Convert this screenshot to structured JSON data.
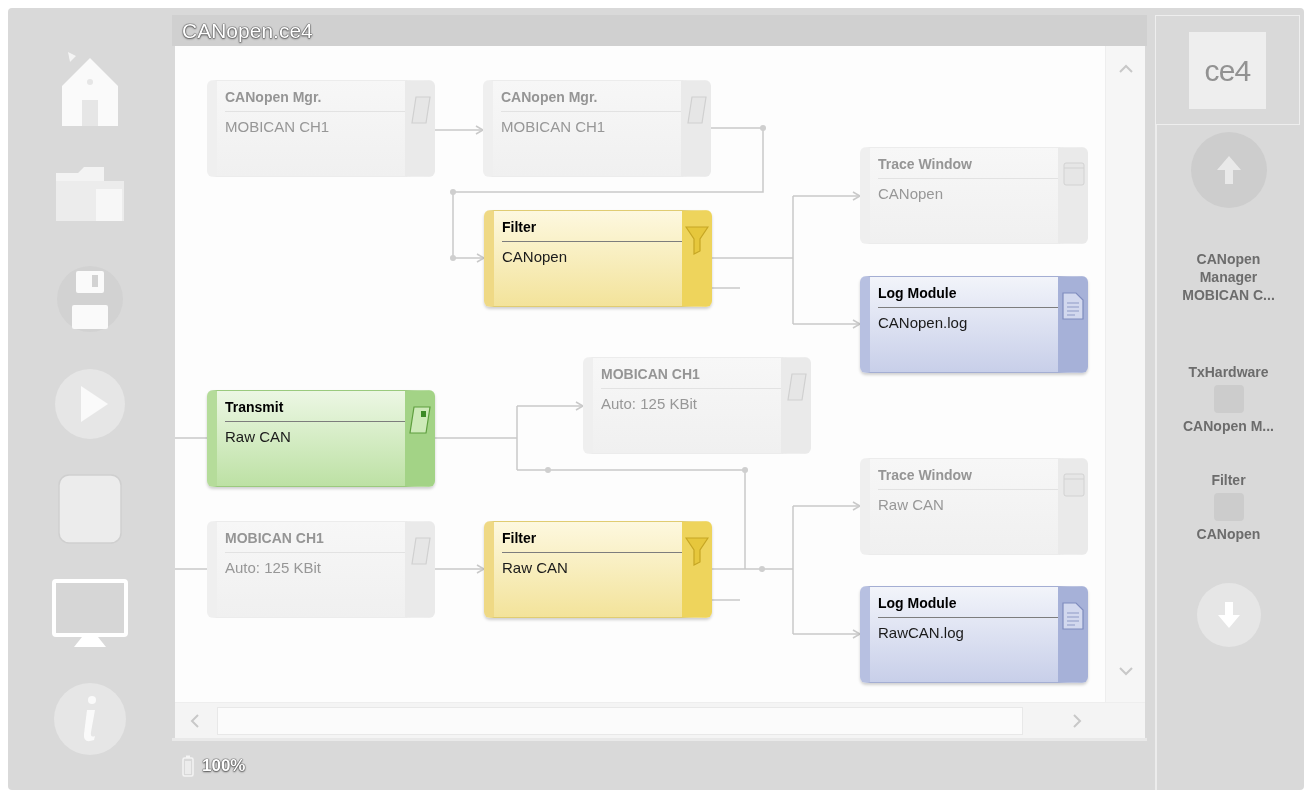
{
  "window": {
    "title": "CANopen.ce4"
  },
  "diagram": {
    "nodes": [
      {
        "kind": "manager",
        "title": "CANopen Mgr.",
        "subtitle": "MOBICAN CH1",
        "disabled": true
      },
      {
        "kind": "manager",
        "title": "CANopen Mgr.",
        "subtitle": "MOBICAN CH1",
        "disabled": true
      },
      {
        "kind": "trace",
        "title": "Trace Window",
        "subtitle": "CANopen",
        "disabled": true
      },
      {
        "kind": "filter",
        "title": "Filter",
        "subtitle": "CANopen",
        "disabled": false
      },
      {
        "kind": "log",
        "title": "Log Module",
        "subtitle": "CANopen.log",
        "disabled": false
      },
      {
        "kind": "hardware",
        "title": "MOBICAN CH1",
        "subtitle": "Auto: 125 KBit",
        "disabled": true
      },
      {
        "kind": "transmit",
        "title": "Transmit",
        "subtitle": "Raw CAN",
        "disabled": false
      },
      {
        "kind": "trace",
        "title": "Trace Window",
        "subtitle": "Raw CAN",
        "disabled": true
      },
      {
        "kind": "hardware",
        "title": "MOBICAN CH1",
        "subtitle": "Auto: 125 KBit",
        "disabled": true
      },
      {
        "kind": "filter",
        "title": "Filter",
        "subtitle": "Raw CAN",
        "disabled": false
      },
      {
        "kind": "log",
        "title": "Log Module",
        "subtitle": "RawCAN.log",
        "disabled": false
      }
    ]
  },
  "status_bar": {
    "battery": "100%"
  },
  "side_panel": {
    "logo": "ce4",
    "heading": "CANopen Manager MOBICAN C...",
    "items": [
      {
        "type": "TxHardware",
        "name": "CANopen M..."
      },
      {
        "type": "Filter",
        "name": "CANopen"
      }
    ]
  }
}
